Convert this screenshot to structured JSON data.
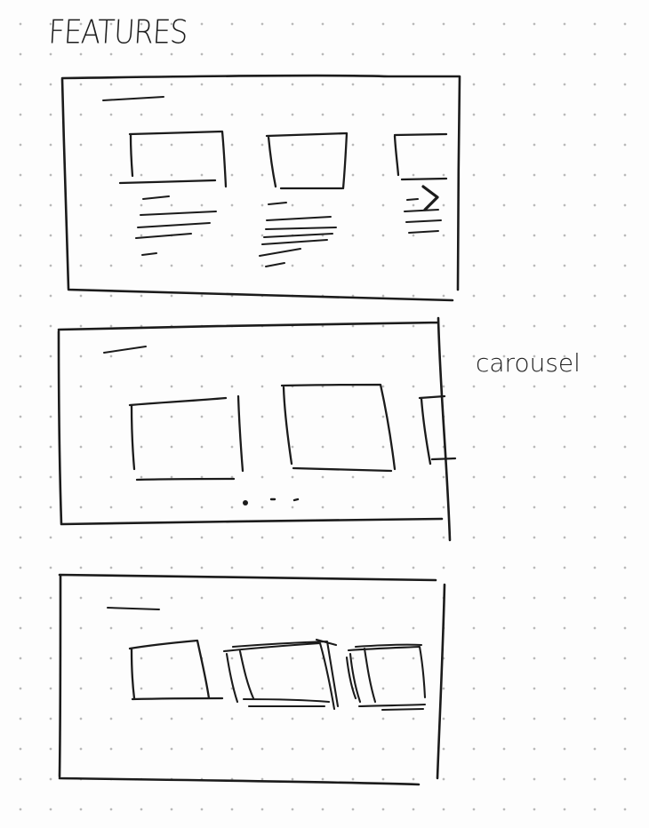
{
  "page_title": "FEATURES",
  "annotations": {
    "carousel": "carousel"
  },
  "wireframes": [
    {
      "id": "grid-with-text",
      "cards": 3,
      "has_next_arrow": true,
      "next_icon": "chevron-right-icon"
    },
    {
      "id": "carousel",
      "cards": 3,
      "has_pagination_dots": true
    },
    {
      "id": "stacked-cards",
      "cards": 3
    }
  ]
}
